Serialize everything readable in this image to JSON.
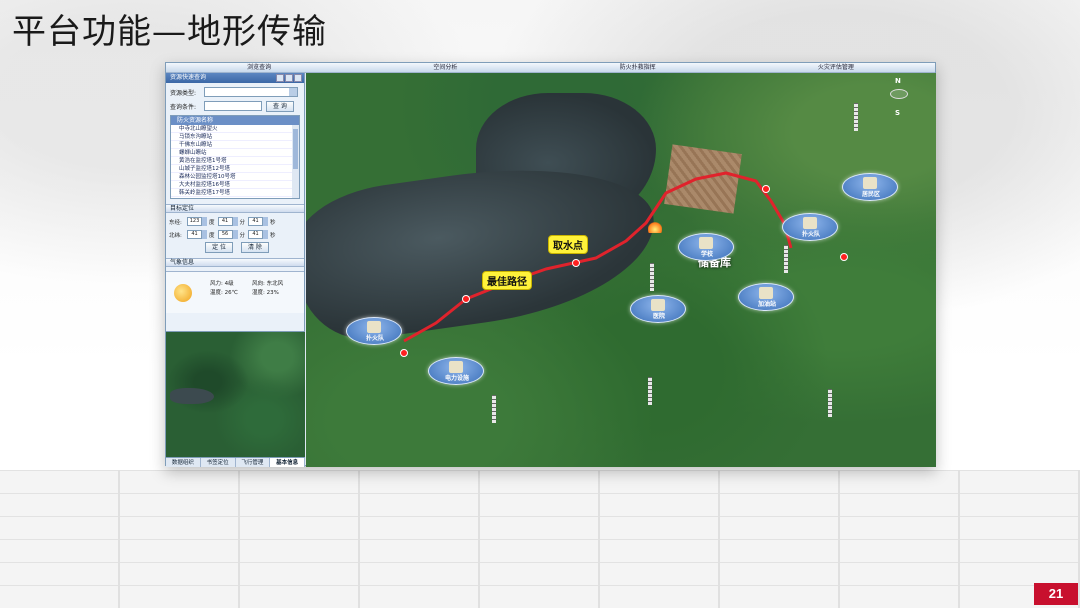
{
  "slide": {
    "title": "平台功能—地形传输",
    "page_number": "21"
  },
  "menu": [
    "浏览查询",
    "空间分析",
    "防火扑救指挥",
    "火灾评估管理"
  ],
  "left_panel": {
    "title": "资源快速查询",
    "query_type_label": "资源类型:",
    "query_cond_label": "查询条件:",
    "query_button": "查 询",
    "list_header": "防火资源名称",
    "list_items": [
      "中寺北山瞭望火",
      "马锁东沟瞭站",
      "千佛东山瞭站",
      "螺蛳山瞭站",
      "黄浩在监控塔1号塔",
      "山城子监控塔12号塔",
      "森林公园监控塔10号塔",
      "大夫村监控塔16号塔",
      "韩关岭监控塔17号塔"
    ],
    "target_section": "目标定位",
    "east_label": "东经:",
    "north_label": "北纬:",
    "east": {
      "deg": "123",
      "min": "41",
      "sec": "41"
    },
    "north": {
      "deg": "41",
      "min": "56",
      "sec": "41"
    },
    "unit_deg": "度",
    "unit_min": "分",
    "unit_sec": "秒",
    "locate_button": "定 位",
    "clear_button": "清 除",
    "weather_section": "气象信息",
    "weather": {
      "wind_force": "风力: 4级",
      "wind_dir": "风向: 东北风",
      "temperature": "温度: 26℃",
      "humidity": "湿度: 23%"
    },
    "bottom_tabs": [
      "数据组织",
      "书签定位",
      "飞行管理",
      "基本信息"
    ]
  },
  "map": {
    "callouts": {
      "water_point": "取水点",
      "best_route": "最佳路径",
      "depot": "储备库"
    },
    "pois": [
      {
        "name": "fire-brigade-west",
        "label": "扑火队"
      },
      {
        "name": "power-facility",
        "label": "电力设施"
      },
      {
        "name": "hospital",
        "label": "医院"
      },
      {
        "name": "school",
        "label": "学校"
      },
      {
        "name": "fire-brigade-east",
        "label": "扑火队"
      },
      {
        "name": "gas-station",
        "label": "加油站"
      },
      {
        "name": "residential",
        "label": "居民区"
      }
    ],
    "compass_n": "N",
    "compass_s": "S"
  },
  "colors": {
    "route": "#e0232c",
    "callout_bg": "#fff23a",
    "page_badge": "#c8102e",
    "poi_blue": "#3a6fb8"
  }
}
